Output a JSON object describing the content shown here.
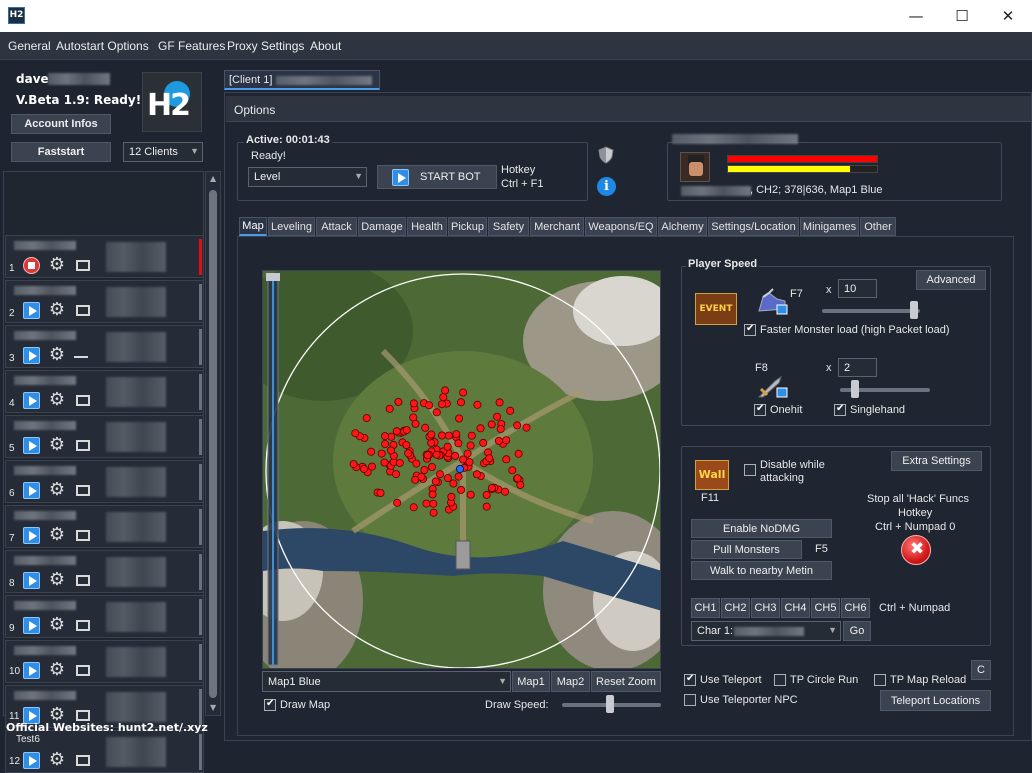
{
  "window": {
    "logo_text": "H2",
    "minimize": "—",
    "maximize": "☐",
    "close": "✕"
  },
  "menu": [
    "General",
    "Autostart Options",
    "GF Features",
    "Proxy Settings",
    "About"
  ],
  "sidebar": {
    "username": "dave",
    "version": "V.Beta 1.9: Ready!",
    "account_infos": "Account Infos",
    "faststart": "Faststart",
    "clients_select": "12 Clients",
    "clients": [
      {
        "num": "1",
        "name": "",
        "state": "stop"
      },
      {
        "num": "2",
        "name": "",
        "state": "play"
      },
      {
        "num": "3",
        "name": "",
        "state": "play"
      },
      {
        "num": "4",
        "name": "",
        "state": "play"
      },
      {
        "num": "5",
        "name": "",
        "state": "play"
      },
      {
        "num": "6",
        "name": "",
        "state": "play"
      },
      {
        "num": "7",
        "name": "",
        "state": "play"
      },
      {
        "num": "8",
        "name": "",
        "state": "play"
      },
      {
        "num": "9",
        "name": "",
        "state": "play"
      },
      {
        "num": "10",
        "name": "",
        "state": "play"
      },
      {
        "num": "11",
        "name": "",
        "state": "play"
      },
      {
        "num": "12",
        "name": "Test6",
        "state": "play"
      }
    ],
    "footer": "Official Websites: hunt2.net/.xyz"
  },
  "client_tab": "[Client 1]",
  "options_header": "Options",
  "status": {
    "active": "Active: 00:01:43",
    "ready": "Ready!",
    "mode_select": "Level",
    "start_bot": "START BOT",
    "hotkey_label": "Hotkey",
    "hotkey_value": "Ctrl + F1"
  },
  "character": {
    "info": ", CH2; 378|636, Map1 Blue",
    "hp_percent": 100,
    "mp_percent": 82,
    "hp_color": "#ff0000",
    "mp_color": "#ffff00"
  },
  "tabs": [
    "Map",
    "Leveling",
    "Attack",
    "Damage",
    "Health",
    "Pickup",
    "Safety",
    "Merchant",
    "Weapons/EQ",
    "Alchemy",
    "Settings/Location",
    "Minigames",
    "Other"
  ],
  "map": {
    "map_select": "Map1 Blue",
    "btn_map1": "Map1",
    "btn_map2": "Map2",
    "btn_reset": "Reset Zoom",
    "draw_map": "Draw Map",
    "draw_speed": "Draw Speed:"
  },
  "player_speed": {
    "title": "Player Speed",
    "advanced": "Advanced",
    "event_icon_text": "EVENT",
    "f7": "F7",
    "x1": "x",
    "speed1": "10",
    "faster_monster": "Faster Monster load (high Packet load)",
    "f8": "F8",
    "x2": "x",
    "speed2": "2",
    "onehit": "Onehit",
    "singlehand": "Singlehand"
  },
  "hack": {
    "extra_settings": "Extra Settings",
    "wall_text": "Wall",
    "disable_line1": "Disable while",
    "disable_line2": "attacking",
    "f11": "F11",
    "stop_line1": "Stop all 'Hack' Funcs",
    "stop_line2": "Hotkey",
    "stop_line3": "Ctrl + Numpad 0",
    "enable_nodmg": "Enable NoDMG",
    "pull_monsters": "Pull Monsters",
    "f5": "F5",
    "walk_metin": "Walk to nearby Metin",
    "channels": [
      "CH1",
      "CH2",
      "CH3",
      "CH4",
      "CH5",
      "CH6"
    ],
    "ctrl_numpad": "Ctrl + Numpad",
    "char_select": "Char 1:",
    "go": "Go"
  },
  "teleport": {
    "use_teleport": "Use Teleport",
    "tp_circle": "TP Circle Run",
    "tp_map_reload": "TP Map Reload",
    "c_btn": "C",
    "use_npc": "Use Teleporter NPC",
    "locations": "Teleport Locations"
  }
}
